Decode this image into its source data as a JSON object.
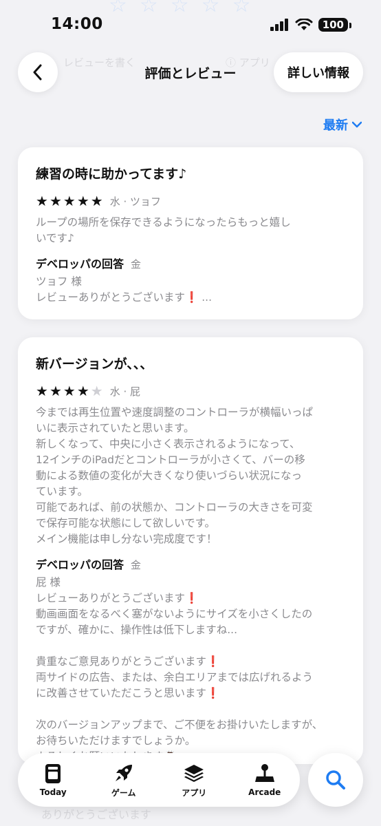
{
  "status": {
    "time": "14:00",
    "battery": "100"
  },
  "nav": {
    "title": "評価とレビュー",
    "info_button": "詳しい情報",
    "ghost_left": "レビューを書く",
    "ghost_right": "ⓘ アプリ"
  },
  "sort": {
    "label": "最新"
  },
  "reviews": [
    {
      "title": "練習の時に助かってます♪",
      "rating": 5,
      "meta": "水 · ツョフ",
      "body": "ループの場所を保存できるようになったらもっと嬉し\nいです♪",
      "dev_label": "デベロッパの回答",
      "dev_day": "金",
      "dev_reply": "ツョフ 様\nレビューありがとうございます❗ ..."
    },
    {
      "title": "新バージョンが、、、",
      "rating": 4,
      "meta": "水 · 屁",
      "body": "今までは再生位置や速度調整のコントローラが横幅いっぱ\nいに表示されていたと思います。\n新しくなって、中央に小さく表示されるようになって、\n12インチのiPadだとコントローラが小さくて、バーの移\n動による数値の変化が大きくなり使いづらい状況になっ\nています。\n可能であれば、前の状態か、コントローラの大きさを可変\nで保存可能な状態にして欲しいです。\nメイン機能は申し分ない完成度です！",
      "dev_label": "デベロッパの回答",
      "dev_day": "金",
      "dev_reply": "屁 様\nレビューありがとうございます❗\n動画画面をなるべく塞がないようにサイズを小さくしたの\nですが、確かに、操作性は低下しますね...\n\n貴重なご意見ありがとうございます❗\n両サイドの広告、または、余白エリアまでは広げれるよう\nに改善させていただこうと思います❗\n\n次のバージョンアップまで、ご不便をお掛けいたしますが、\nお待ちいただけますでしょうか。\nよろしくお願いいたします🙇"
    }
  ],
  "tabs": [
    {
      "label": "Today",
      "icon": "today-icon"
    },
    {
      "label": "ゲーム",
      "icon": "rocket-icon"
    },
    {
      "label": "アプリ",
      "icon": "apps-stack-icon"
    },
    {
      "label": "Arcade",
      "icon": "joystick-icon"
    }
  ],
  "bottom_ghost": "ありがとうございます",
  "colors": {
    "accent": "#1e7cf2",
    "background": "#f2f2f5",
    "secondary_text": "#8a8a8e"
  }
}
